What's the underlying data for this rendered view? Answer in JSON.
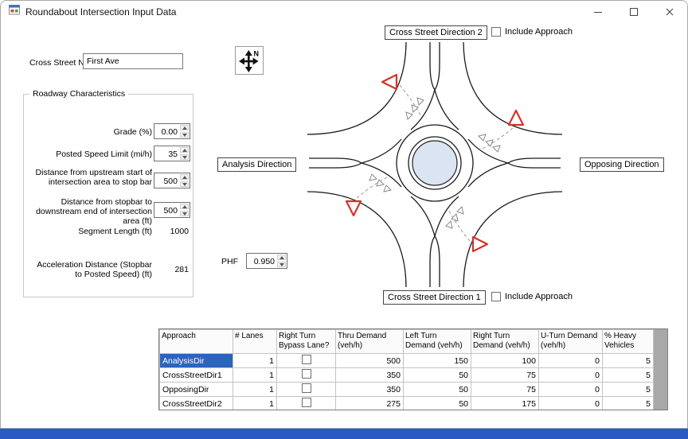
{
  "window": {
    "title": "Roundabout Intersection Input Data"
  },
  "colors": {
    "selection_blue": "#2a65bd",
    "taskbar_blue": "#2b59c3",
    "island_fill": "#dbe4f2",
    "yield_red": "#d63327"
  },
  "form": {
    "cross_street_name": {
      "label": "Cross Street Name",
      "value": "First Ave"
    },
    "roadway": {
      "title": "Roadway Characteristics",
      "grade": {
        "label": "Grade (%)",
        "value": "0.00"
      },
      "speed": {
        "label": "Posted Speed Limit (mi/h)",
        "value": "35"
      },
      "dist_upstream": {
        "label": "Distance from upstream start of intersection area to stop bar",
        "value": "500"
      },
      "dist_downstream": {
        "label": "Distance from stopbar to downstream end of intersection area (ft)",
        "value": "500"
      },
      "segment_length": {
        "label": "Segment Length (ft)",
        "value": "1000"
      },
      "accel_distance": {
        "label": "Acceleration Distance (Stopbar to Posted Speed) (ft)",
        "value": "281"
      }
    },
    "phf": {
      "label": "PHF",
      "value": "0.950"
    }
  },
  "diagram": {
    "north": "N",
    "analysis_direction": "Analysis Direction",
    "opposing_direction": "Opposing Direction",
    "cross_street_direction_2": "Cross Street Direction 2",
    "cross_street_direction_1": "Cross Street Direction 1",
    "include_approach_top": "Include Approach",
    "include_approach_bottom": "Include Approach"
  },
  "grid": {
    "headers": [
      "Approach",
      "# Lanes",
      "Right Turn Bypass Lane?",
      "Thru Demand (veh/h)",
      "Left Turn Demand (veh/h)",
      "Right Turn Demand (veh/h)",
      "U-Turn Demand (veh/h)",
      "% Heavy Vehicles"
    ],
    "rows": [
      {
        "approach": "AnalysisDir",
        "lanes": "1",
        "bypass": false,
        "thru": "500",
        "left": "150",
        "right": "100",
        "uturn": "0",
        "heavy": "5",
        "selected": true
      },
      {
        "approach": "CrossStreetDir1",
        "lanes": "1",
        "bypass": false,
        "thru": "350",
        "left": "50",
        "right": "75",
        "uturn": "0",
        "heavy": "5",
        "selected": false
      },
      {
        "approach": "OpposingDir",
        "lanes": "1",
        "bypass": false,
        "thru": "350",
        "left": "50",
        "right": "75",
        "uturn": "0",
        "heavy": "5",
        "selected": false
      },
      {
        "approach": "CrossStreetDir2",
        "lanes": "1",
        "bypass": false,
        "thru": "275",
        "left": "50",
        "right": "175",
        "uturn": "0",
        "heavy": "5",
        "selected": false
      }
    ]
  }
}
